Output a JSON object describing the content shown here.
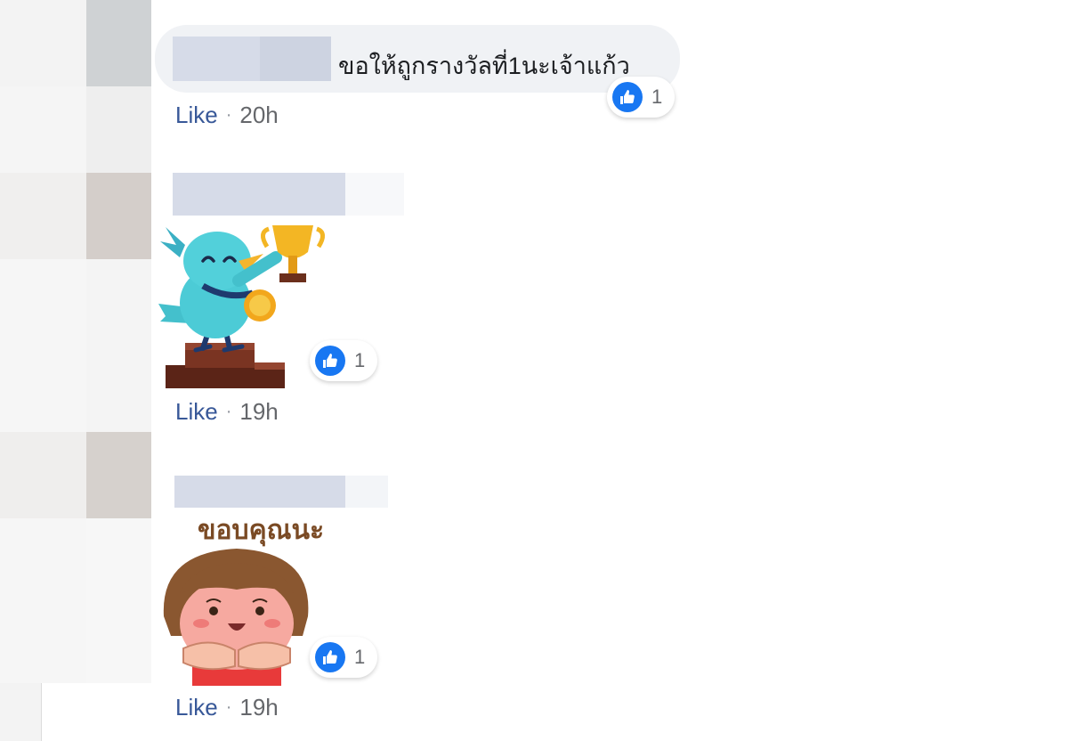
{
  "comments": [
    {
      "text": "ขอให้ถูกรางวัลที่1นะเจ้าแก้ว",
      "reaction_count": "1",
      "action_label": "Like",
      "time": "20h"
    },
    {
      "sticker": "blue bird holding trophy",
      "reaction_count": "1",
      "action_label": "Like",
      "time": "19h"
    },
    {
      "sticker": "girl saying thank you",
      "sticker_caption": "ขอบคุณนะ",
      "reaction_count": "1",
      "action_label": "Like",
      "time": "19h"
    }
  ],
  "reaction_icon": "thumbs-up-icon",
  "colors": {
    "like_blue": "#1877f2",
    "link_blue": "#385898",
    "bubble_bg": "#f0f2f5"
  }
}
